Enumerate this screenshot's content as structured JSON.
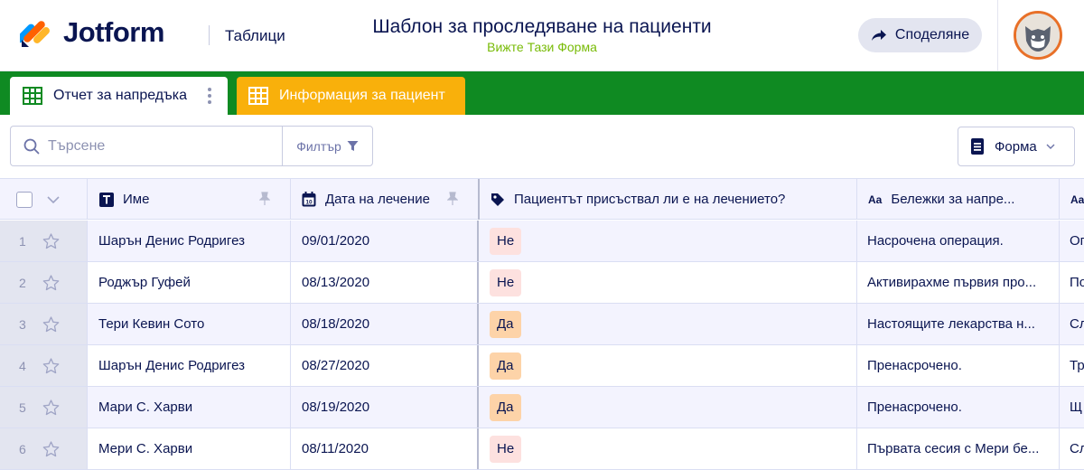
{
  "header": {
    "logo_text": "Jotform",
    "app_name": "Таблици",
    "title": "Шаблон за проследяване на пациенти",
    "form_link": "Вижте Тази Форма",
    "share_label": "Споделяне"
  },
  "tabs": [
    {
      "label": "Отчет за напредъка",
      "active": true,
      "color": "#ffffff"
    },
    {
      "label": "Информация за пациент",
      "active": false,
      "color": "#f9b00b"
    }
  ],
  "toolbar": {
    "search_placeholder": "Търсене",
    "filter_label": "Филтър",
    "form_label": "Форма"
  },
  "columns": [
    {
      "label": "Име",
      "icon": "text-type-icon"
    },
    {
      "label": "Дата на лечение",
      "icon": "calendar-icon"
    },
    {
      "label": "Пациентът присъствал ли е на лечението?",
      "icon": "tag-icon"
    },
    {
      "label": "Бележки за напре...",
      "icon": "text-aa-icon"
    },
    {
      "label": "",
      "icon": "text-aa-icon"
    }
  ],
  "rows": [
    {
      "num": "1",
      "name": "Шарън Денис Родригез",
      "date": "09/01/2020",
      "attended": "Не",
      "notes": "Насрочена операция.",
      "more": "Оп"
    },
    {
      "num": "2",
      "name": "Роджър Гуфей",
      "date": "08/13/2020",
      "attended": "Не",
      "notes": "Активирахме първия про...",
      "more": "По"
    },
    {
      "num": "3",
      "name": "Тери Кевин Сото",
      "date": "08/18/2020",
      "attended": "Да",
      "notes": "Настоящите лекарства н...",
      "more": "Сл"
    },
    {
      "num": "4",
      "name": "Шарън Денис Родригез",
      "date": "08/27/2020",
      "attended": "Да",
      "notes": "Пренасрочено.",
      "more": "Тр"
    },
    {
      "num": "5",
      "name": "Мари С. Харви",
      "date": "08/19/2020",
      "attended": "Да",
      "notes": "Пренасрочено.",
      "more": "Щ"
    },
    {
      "num": "6",
      "name": "Мери С. Харви",
      "date": "08/11/2020",
      "attended": "Не",
      "notes": "Първата сесия с Мери бе...",
      "more": "Сл"
    }
  ],
  "colors": {
    "brand_green": "#0f8a22",
    "tab_orange": "#f9b00b",
    "pill_no": "#fde1df",
    "pill_yes": "#fdd3a8",
    "link_green": "#78bb07"
  }
}
